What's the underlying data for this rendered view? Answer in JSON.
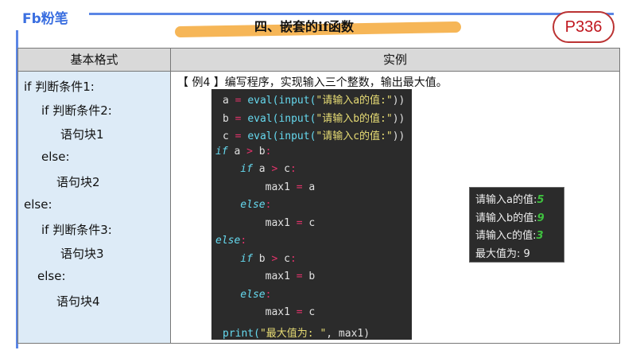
{
  "brand": "Fb粉笔",
  "title": "四、嵌套的if函数",
  "page_badge": "P336",
  "table": {
    "headers": [
      "基本格式",
      "实例"
    ],
    "format_lines": [
      "if  判断条件1:",
      "if  判断条件2:",
      "语句块1",
      "else:",
      "语句块2",
      "else:",
      "if  判断条件3:",
      "语句块3",
      "else:",
      "语句块4"
    ],
    "example_desc": "【 例4 】编写程序，实现输入三个整数，输出最大值。"
  },
  "code_lines": [
    [
      [
        "id",
        "a "
      ],
      [
        "op",
        "= "
      ],
      [
        "fn",
        "eval(input("
      ],
      [
        "str",
        "\"请输入a的值:\""
      ],
      [
        "p",
        "))"
      ]
    ],
    [
      [
        "id",
        "b "
      ],
      [
        "op",
        "= "
      ],
      [
        "fn",
        "eval(input("
      ],
      [
        "str",
        "\"请输入b的值:\""
      ],
      [
        "p",
        "))"
      ]
    ],
    [
      [
        "id",
        "c "
      ],
      [
        "op",
        "= "
      ],
      [
        "fn",
        "eval(input("
      ],
      [
        "str",
        "\"请输入c的值:\""
      ],
      [
        "p",
        "))"
      ]
    ],
    [
      [
        "kw",
        "if"
      ],
      [
        "id",
        " a "
      ],
      [
        "op",
        ">"
      ],
      [
        "id",
        " b"
      ],
      [
        "op",
        ":"
      ]
    ],
    [
      [
        "kw",
        "    if"
      ],
      [
        "id",
        " a "
      ],
      [
        "op",
        ">"
      ],
      [
        "id",
        " c"
      ],
      [
        "op",
        ":"
      ]
    ],
    [
      [
        "id",
        "        max1 "
      ],
      [
        "op",
        "="
      ],
      [
        "id",
        " a"
      ]
    ],
    [
      [
        "kw",
        "    else"
      ],
      [
        "op",
        ":"
      ]
    ],
    [
      [
        "id",
        "        max1 "
      ],
      [
        "op",
        "="
      ],
      [
        "id",
        " c"
      ]
    ],
    [
      [
        "kw",
        "else"
      ],
      [
        "op",
        ":"
      ]
    ],
    [
      [
        "kw",
        "    if"
      ],
      [
        "id",
        " b "
      ],
      [
        "op",
        ">"
      ],
      [
        "id",
        " c"
      ],
      [
        "op",
        ":"
      ]
    ],
    [
      [
        "id",
        "        max1 "
      ],
      [
        "op",
        "="
      ],
      [
        "id",
        " b"
      ]
    ],
    [
      [
        "kw",
        "    else"
      ],
      [
        "op",
        ":"
      ]
    ],
    [
      [
        "id",
        "        max1 "
      ],
      [
        "op",
        "="
      ],
      [
        "id",
        " c"
      ]
    ],
    [
      [
        "fn",
        "print("
      ],
      [
        "str",
        "\"最大值为: \""
      ],
      [
        "p",
        ", max1)"
      ]
    ]
  ],
  "output": [
    {
      "label": "请输入a的值:",
      "value": "5"
    },
    {
      "label": "请输入b的值:",
      "value": "9"
    },
    {
      "label": "请输入c的值:",
      "value": "3"
    },
    {
      "label": "最大值为:   ",
      "value": "9",
      "plain": true
    }
  ]
}
